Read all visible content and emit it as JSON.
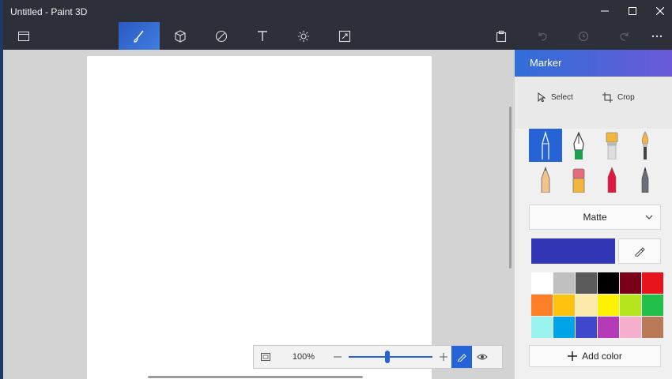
{
  "window": {
    "title": "Untitled - Paint 3D"
  },
  "toolbar": {
    "menu_icon": "menu-icon",
    "tools": [
      {
        "name": "brushes",
        "icon": "brush-icon",
        "active": true
      },
      {
        "name": "3d-shapes",
        "icon": "cube-icon",
        "active": false
      },
      {
        "name": "stickers",
        "icon": "sticker-icon",
        "active": false
      },
      {
        "name": "text",
        "icon": "text-icon",
        "active": false
      },
      {
        "name": "effects",
        "icon": "effects-icon",
        "active": false
      },
      {
        "name": "canvas",
        "icon": "canvas-resize-icon",
        "active": false
      }
    ],
    "right_icons": [
      "paste-icon",
      "undo-icon",
      "history-icon",
      "redo-icon",
      "more-icon"
    ]
  },
  "zoom": {
    "fit_icon": "fit-screen-icon",
    "level": "100%",
    "slider_value": 0.5
  },
  "panel": {
    "title": "Marker",
    "select_label": "Select",
    "crop_label": "Crop",
    "brushes": [
      "marker",
      "calligraphy-pen",
      "oil-brush",
      "watercolor",
      "pencil",
      "eraser",
      "crayon",
      "pixel-pen"
    ],
    "selected_brush": "marker",
    "finish": "Matte",
    "current_color": "#3136b4",
    "add_color_label": "Add color",
    "palette": [
      "#ffffff",
      "#c0c0c0",
      "#5a5a5a",
      "#000000",
      "#7a0019",
      "#e8141c",
      "#ff7f27",
      "#ffc20e",
      "#fde9a9",
      "#fff200",
      "#b5e61d",
      "#22c04a",
      "#99f3ee",
      "#00a2e8",
      "#3f48cc",
      "#b43ab8",
      "#f5aecb",
      "#b97a57"
    ]
  },
  "colors": {
    "accent": "#2563d6",
    "titlebar": "#2d3039",
    "workspace": "#d3d3d3"
  }
}
